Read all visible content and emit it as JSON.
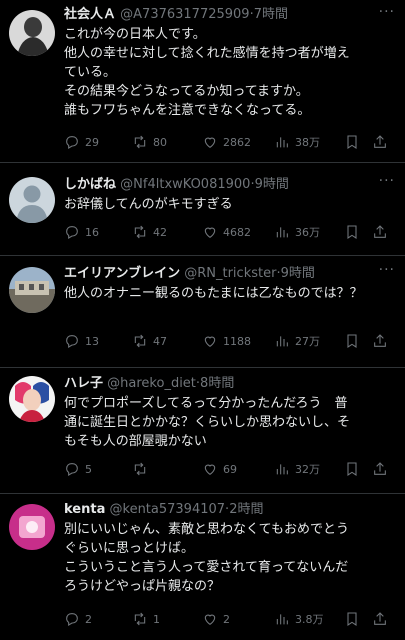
{
  "posts": [
    {
      "name": "社会人Ａ",
      "handle": "@A7376317725909",
      "time": "7時間",
      "text": "これが今の日本人です。\n他人の幸せに対して捻くれた感情を持つ者が増え\nている。\nその結果今どうなってるか知ってますか。\n誰もフワちゃんを注意できなくなってる。",
      "replies": "29",
      "retweets": "80",
      "likes": "2862",
      "views": "38万",
      "avatar": "statue-photo"
    },
    {
      "name": "しかばね",
      "handle": "@Nf4ltxwKO081900",
      "time": "9時間",
      "text": "お辞儀してんのがキモすぎる",
      "replies": "16",
      "retweets": "42",
      "likes": "4682",
      "views": "36万",
      "avatar": "default-user"
    },
    {
      "name": "エイリアンブレイン",
      "handle": "@RN_trickster",
      "time": "9時間",
      "text": "他人のオナニー観るのもたまには乙なものでは？？",
      "replies": "13",
      "retweets": "47",
      "likes": "1188",
      "views": "27万",
      "avatar": "building-photo"
    },
    {
      "name": "ハレ子",
      "handle": "@hareko_diet",
      "time": "8時間",
      "text": "何でプロポーズしてるって分かったんだろう　普\n通に誕生日とかかな？くらいしか思わないし、そ\nもそも人の部屋覗かない",
      "replies": "5",
      "retweets": "",
      "likes": "69",
      "views": "32万",
      "avatar": "character-photo"
    },
    {
      "name": "kenta",
      "handle": "@kenta57394107",
      "time": "2時間",
      "text": "別にいいじゃん、素敵と思わなくてもおめでとう\nぐらいに思っとけば。\nこういうこと言う人って愛されて育ってないんだ\nろうけどやっぱ片親なの？",
      "replies": "2",
      "retweets": "1",
      "likes": "2",
      "views": "3.8万",
      "avatar": "pink-photo"
    }
  ],
  "separator": "·",
  "more": "···",
  "colors": {
    "background": "#000000",
    "text": "#e7e9ea",
    "muted": "#71767b",
    "border": "#2f3336"
  },
  "icons": [
    "reply-icon",
    "retweet-icon",
    "like-icon",
    "views-icon",
    "bookmark-icon",
    "share-icon",
    "more-icon"
  ]
}
